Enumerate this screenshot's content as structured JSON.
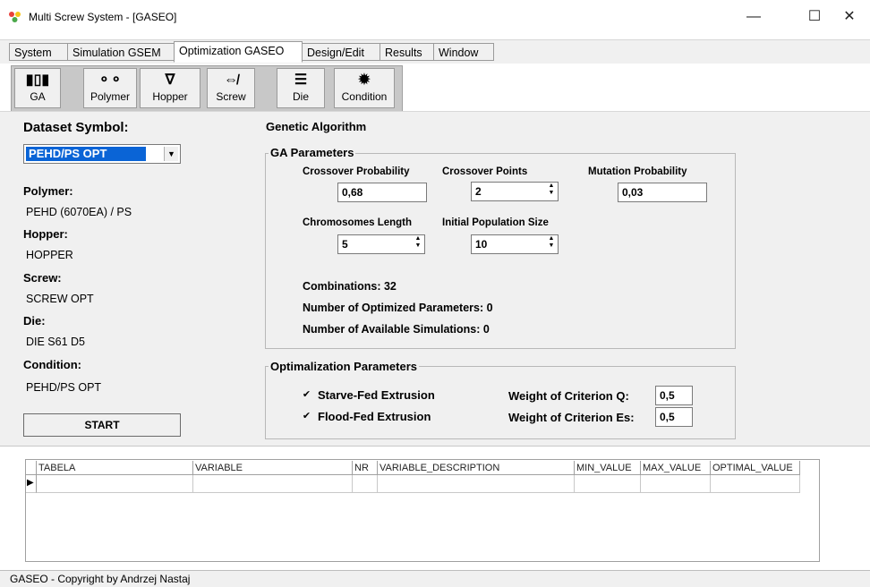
{
  "window": {
    "title": "Multi Screw System - [GASEO]",
    "minimize_glyph": "—",
    "maximize_glyph": "☐",
    "close_glyph": "✕"
  },
  "menu_tabs": [
    {
      "label": "System"
    },
    {
      "label": "Simulation GSEM"
    },
    {
      "label": "Optimization GASEO",
      "active": true
    },
    {
      "label": "Design/Edit"
    },
    {
      "label": "Results"
    },
    {
      "label": "Window"
    }
  ],
  "toolbar": {
    "items": [
      {
        "label": "GA",
        "icon": "ga-icon",
        "glyph": "▮▯▮"
      },
      {
        "label": "Polymer",
        "icon": "polymer-icon",
        "glyph": "⚬⚬"
      },
      {
        "label": "Hopper",
        "icon": "hopper-icon",
        "glyph": "∇"
      },
      {
        "label": "Screw",
        "icon": "screw-icon",
        "glyph": "⇎"
      },
      {
        "label": "Die",
        "icon": "die-icon",
        "glyph": "☰"
      },
      {
        "label": "Condition",
        "icon": "gear-icon",
        "glyph": "✹"
      }
    ]
  },
  "left_panel": {
    "dataset_symbol_label": "Dataset Symbol:",
    "dataset_symbol_value": "PEHD/PS OPT",
    "polymer_label": "Polymer:",
    "polymer_value": "PEHD (6070EA) / PS",
    "hopper_label": "Hopper:",
    "hopper_value": "HOPPER",
    "screw_label": "Screw:",
    "screw_value": "SCREW OPT",
    "die_label": "Die:",
    "die_value": "DIE S61 D5",
    "condition_label": "Condition:",
    "condition_value": "PEHD/PS OPT",
    "start_button": "START"
  },
  "ga": {
    "title": "Genetic Algorithm",
    "params_caption": "GA Parameters",
    "crossover_probability_label": "Crossover Probability",
    "crossover_probability_value": "0,68",
    "crossover_points_label": "Crossover Points",
    "crossover_points_value": "2",
    "mutation_probability_label": "Mutation Probability",
    "mutation_probability_value": "0,03",
    "chromosomes_length_label": "Chromosomes Length",
    "chromosomes_length_value": "5",
    "initial_population_label": "Initial Population Size",
    "initial_population_value": "10",
    "combinations_text": "Combinations: 32",
    "optimized_params_text": "Number of Optimized Parameters:  0",
    "available_sims_text": "Number of Available Simulations:  0"
  },
  "opt": {
    "caption": "Optimalization Parameters",
    "starve_fed_label": "Starve-Fed Extrusion",
    "starve_fed_checked": true,
    "flood_fed_label": "Flood-Fed Extrusion",
    "flood_fed_checked": true,
    "weight_q_label": "Weight of Criterion Q:",
    "weight_q_value": "0,5",
    "weight_es_label": "Weight of Criterion Es:",
    "weight_es_value": "0,5"
  },
  "grid": {
    "columns": [
      "TABELA",
      "VARIABLE",
      "NR",
      "VARIABLE_DESCRIPTION",
      "MIN_VALUE",
      "MAX_VALUE",
      "OPTIMAL_VALUE"
    ]
  },
  "status": {
    "text": "GASEO - Copyright by Andrzej Nastaj"
  }
}
